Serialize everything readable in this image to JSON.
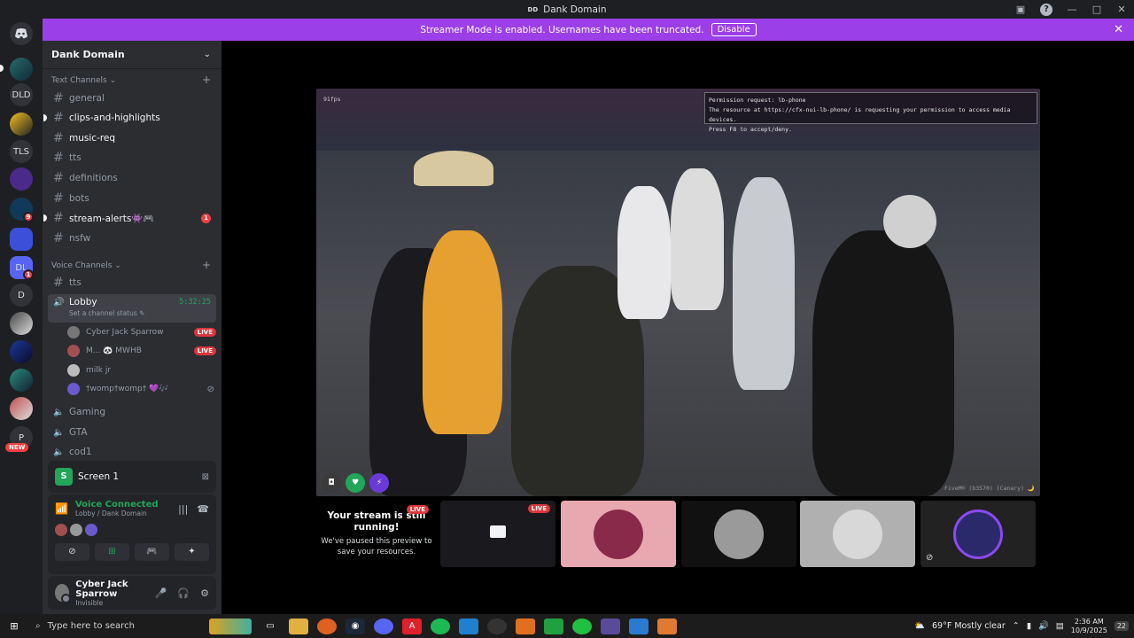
{
  "window": {
    "app_icon_text": "DD",
    "title": "Dank Domain"
  },
  "banner": {
    "text": "Streamer Mode is enabled. Usernames have been truncated.",
    "button": "Disable"
  },
  "rail": {
    "servers": [
      "DLD",
      "TLS",
      "DL",
      "D",
      "P"
    ],
    "badges": [
      "9",
      "1"
    ],
    "new_label": "NEW"
  },
  "server": {
    "name": "Dank Domain"
  },
  "text_category": "Text Channels",
  "voice_category": "Voice Channels",
  "text_channels": [
    {
      "name": "general"
    },
    {
      "name": "clips-and-highlights"
    },
    {
      "name": "music-req"
    },
    {
      "name": "tts"
    },
    {
      "name": "definitions"
    },
    {
      "name": "bots"
    },
    {
      "name": "stream-alerts👾🎮",
      "mentions": "1"
    },
    {
      "name": "nsfw"
    }
  ],
  "voice_channels": {
    "tts": "tts",
    "lobby": {
      "name": "Lobby",
      "timer": "5:32:25",
      "status": "Set a channel status ✎"
    },
    "users": [
      {
        "name": "Cyber Jack Sparrow",
        "live": "LIVE"
      },
      {
        "name": "M... 🐼 MWHB",
        "live": "LIVE"
      },
      {
        "name": "milk jr"
      },
      {
        "name": "†womp†womp† 💜🎶"
      }
    ],
    "others": [
      "Gaming",
      "GTA",
      "cod1"
    ]
  },
  "screenshare": {
    "label": "Screen 1"
  },
  "voice": {
    "status": "Voice Connected",
    "location": "Lobby / Dank Domain"
  },
  "user": {
    "name": "Cyber Jack Sparrow",
    "status": "Invisible"
  },
  "stream": {
    "fps": "91fps",
    "permission": [
      "Permission request: lb-phone",
      "The resource at https://cfx-nui-lb-phone/ is requesting your permission to access media devices.",
      "Press F8 to accept/deny."
    ],
    "watermark": "FiveM® (b3570) (Canary) 🌙"
  },
  "tiles": {
    "msg_title": "Your stream is still running!",
    "msg_body": "We've paused this preview to save your resources.",
    "live": "LIVE"
  },
  "taskbar": {
    "search_placeholder": "Type here to search",
    "weather": "69°F  Mostly clear",
    "time": "2:36 AM",
    "date": "10/9/2025",
    "notifications": "22"
  }
}
